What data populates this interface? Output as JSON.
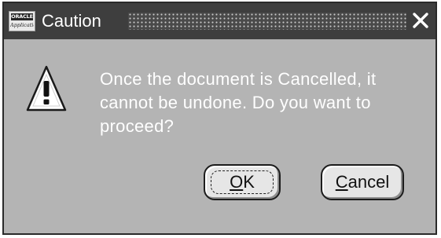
{
  "window": {
    "title": "Caution",
    "logo_top_text": "ORACLE",
    "logo_bottom_text": "Applications"
  },
  "message": " Once the document is Cancelled, it\ncannot be undone.  Do you want to\nproceed?",
  "buttons": {
    "ok": {
      "label": "OK",
      "mnemonic": "O",
      "rest": "K"
    },
    "cancel": {
      "label": "Cancel",
      "mnemonic": "C",
      "rest": "ancel"
    }
  },
  "icons": {
    "logo": "oracle-applications-logo",
    "warning": "warning-triangle-icon",
    "close": "close-icon"
  }
}
